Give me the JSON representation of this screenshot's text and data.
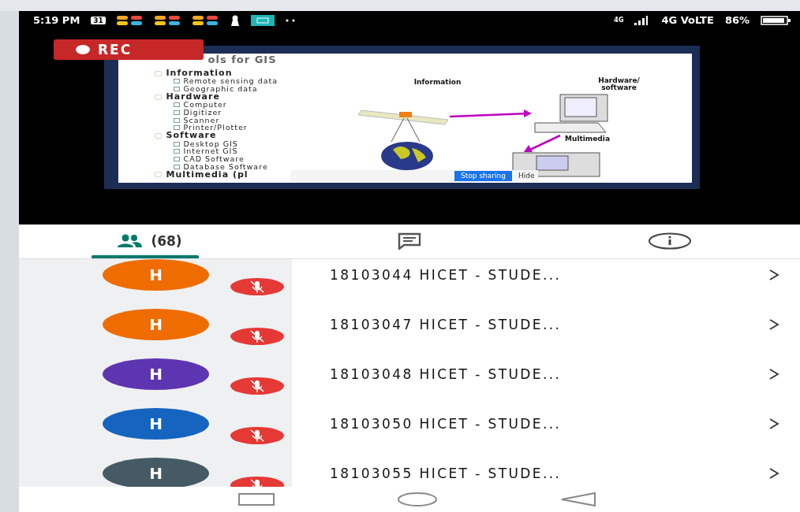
{
  "status_bar": {
    "time": "5:19 PM",
    "calendar_day": "31",
    "network": "4G",
    "network_type": "4G VoLTE",
    "battery": "86%"
  },
  "recording": {
    "label": "REC"
  },
  "shared_slide": {
    "title": "ols for GIS",
    "outline": [
      {
        "text": "Information",
        "children": [
          {
            "text": "Remote sensing data"
          },
          {
            "text": "Geographic data"
          }
        ]
      },
      {
        "text": "Hardware",
        "children": [
          {
            "text": "Computer"
          },
          {
            "text": "Digitizer"
          },
          {
            "text": "Scanner"
          },
          {
            "text": "Printer/Plotter"
          }
        ]
      },
      {
        "text": "Software",
        "children": [
          {
            "text": "Desktop GIS"
          },
          {
            "text": "Internet GIS"
          },
          {
            "text": "CAD Software"
          },
          {
            "text": "Database Software"
          }
        ]
      },
      {
        "text": "Multimedia (pl"
      }
    ],
    "diagram_labels": [
      "Information",
      "Hardware/ software",
      "Multimedia"
    ],
    "sharing_bar": {
      "stop_button": "Stop sharing",
      "hide_button": "Hide"
    }
  },
  "tabs": [
    {
      "kind": "people",
      "label": "(68)",
      "selected": true
    },
    {
      "kind": "chat",
      "selected": false
    },
    {
      "kind": "info",
      "selected": false
    }
  ],
  "participants": [
    {
      "initial": "H",
      "color": "#ef6c00",
      "muted": true,
      "name": "18103044 HICET - STUDE..."
    },
    {
      "initial": "H",
      "color": "#ef6c00",
      "muted": true,
      "name": "18103047 HICET - STUDE..."
    },
    {
      "initial": "H",
      "color": "#5e35b1",
      "muted": true,
      "name": "18103048 HICET - STUDE..."
    },
    {
      "initial": "H",
      "color": "#1565c0",
      "muted": true,
      "name": "18103050 HICET - STUDE..."
    },
    {
      "initial": "H",
      "color": "#455a64",
      "muted": true,
      "name": "18103055 HICET - STUDE..."
    }
  ]
}
